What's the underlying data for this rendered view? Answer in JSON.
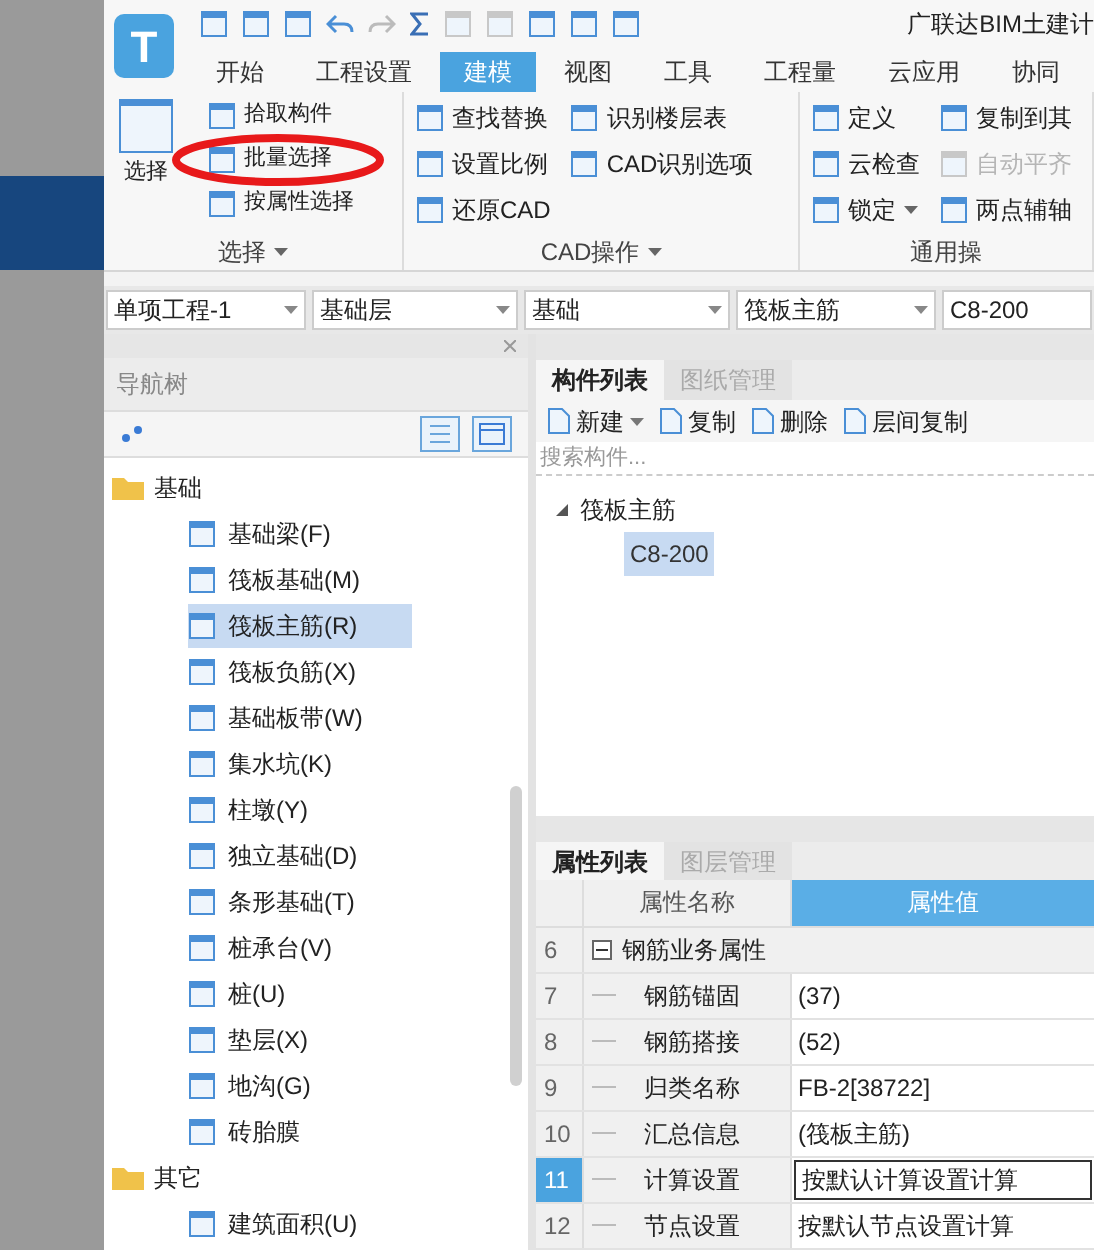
{
  "window": {
    "title": "广联达BIM土建计"
  },
  "app_logo": {
    "letter": "T"
  },
  "menu_tabs": [
    {
      "label": "开始",
      "selected": false
    },
    {
      "label": "工程设置",
      "selected": false
    },
    {
      "label": "建模",
      "selected": true
    },
    {
      "label": "视图",
      "selected": false
    },
    {
      "label": "工具",
      "selected": false
    },
    {
      "label": "工程量",
      "selected": false
    },
    {
      "label": "云应用",
      "selected": false
    },
    {
      "label": "协同",
      "selected": false
    }
  ],
  "ribbon": [
    {
      "label": "选择",
      "columns": [
        [
          {
            "label": "选择",
            "kind": "large",
            "disabled": false,
            "menu": false
          }
        ],
        [
          {
            "label": "拾取构件",
            "kind": "small",
            "disabled": false,
            "menu": false
          },
          {
            "label": "批量选择",
            "kind": "small",
            "disabled": false,
            "menu": false
          },
          {
            "label": "按属性选择",
            "kind": "small",
            "disabled": false,
            "menu": false
          }
        ]
      ]
    },
    {
      "label": "CAD操作",
      "columns": [
        [
          {
            "label": "查找替换",
            "kind": "small",
            "disabled": false,
            "menu": false
          },
          {
            "label": "设置比例",
            "kind": "small",
            "disabled": false,
            "menu": false
          },
          {
            "label": "还原CAD",
            "kind": "small",
            "disabled": false,
            "menu": false
          }
        ],
        [
          {
            "label": "识别楼层表",
            "kind": "small",
            "disabled": false,
            "menu": false
          },
          {
            "label": "CAD识别选项",
            "kind": "small",
            "disabled": false,
            "menu": false
          }
        ]
      ]
    },
    {
      "label": "通用操",
      "columns": [
        [
          {
            "label": "定义",
            "kind": "small",
            "disabled": false,
            "menu": false
          },
          {
            "label": "云检查",
            "kind": "small",
            "disabled": false,
            "menu": false
          },
          {
            "label": "锁定",
            "kind": "small",
            "disabled": false,
            "menu": true
          }
        ],
        [
          {
            "label": "复制到其",
            "kind": "small",
            "disabled": false,
            "menu": false
          },
          {
            "label": "自动平齐",
            "kind": "small",
            "disabled": true,
            "menu": false
          },
          {
            "label": "两点辅轴",
            "kind": "small",
            "disabled": false,
            "menu": false
          }
        ]
      ]
    }
  ],
  "selectors": [
    {
      "value": "单项工程-1",
      "caret": true
    },
    {
      "value": "基础层",
      "caret": true
    },
    {
      "value": "基础",
      "caret": true
    },
    {
      "value": "筏板主筋",
      "caret": true
    },
    {
      "value": "C8-200",
      "caret": false
    }
  ],
  "nav_tree": {
    "title": "导航树",
    "folders": [
      {
        "label": "基础",
        "children": [
          {
            "label": "基础梁(F)",
            "selected": false
          },
          {
            "label": "筏板基础(M)",
            "selected": false
          },
          {
            "label": "筏板主筋(R)",
            "selected": true
          },
          {
            "label": "筏板负筋(X)",
            "selected": false
          },
          {
            "label": "基础板带(W)",
            "selected": false
          },
          {
            "label": "集水坑(K)",
            "selected": false
          },
          {
            "label": "柱墩(Y)",
            "selected": false
          },
          {
            "label": "独立基础(D)",
            "selected": false
          },
          {
            "label": "条形基础(T)",
            "selected": false
          },
          {
            "label": "桩承台(V)",
            "selected": false
          },
          {
            "label": "桩(U)",
            "selected": false
          },
          {
            "label": "垫层(X)",
            "selected": false
          },
          {
            "label": "地沟(G)",
            "selected": false
          },
          {
            "label": "砖胎膜",
            "selected": false
          }
        ]
      },
      {
        "label": "其它",
        "children": [
          {
            "label": "建筑面积(U)",
            "selected": false
          }
        ]
      }
    ]
  },
  "component_panel": {
    "tabs": [
      {
        "label": "构件列表",
        "selected": true
      },
      {
        "label": "图纸管理",
        "selected": false
      }
    ],
    "toolbar": [
      {
        "label": "新建",
        "menu": true
      },
      {
        "label": "复制",
        "menu": false
      },
      {
        "label": "删除",
        "menu": false
      },
      {
        "label": "层间复制",
        "menu": false
      }
    ],
    "search": {
      "placeholder": "搜索构件..."
    },
    "tree": [
      {
        "label": "筏板主筋",
        "expanded": true,
        "children": [
          {
            "label": "C8-200",
            "selected": true
          }
        ]
      }
    ]
  },
  "properties": {
    "tabs": [
      {
        "label": "属性列表",
        "selected": true
      },
      {
        "label": "图层管理",
        "selected": false
      }
    ],
    "columns": [
      "属性名称",
      "属性值"
    ],
    "rows": [
      {
        "index": "6",
        "name": "钢筋业务属性",
        "kind": "group",
        "expanded": true,
        "selected": false
      },
      {
        "index": "7",
        "name": "钢筋锚固",
        "value": "(37)",
        "kind": "item",
        "selected": false
      },
      {
        "index": "8",
        "name": "钢筋搭接",
        "value": "(52)",
        "kind": "item",
        "selected": false
      },
      {
        "index": "9",
        "name": "归类名称",
        "value": "FB-2[38722]",
        "kind": "item",
        "selected": false
      },
      {
        "index": "10",
        "name": "汇总信息",
        "value": "(筏板主筋)",
        "kind": "item",
        "selected": false
      },
      {
        "index": "11",
        "name": "计算设置",
        "value": "按默认计算设置计算",
        "kind": "item",
        "selected": true
      },
      {
        "index": "12",
        "name": "节点设置",
        "value": "按默认节点设置计算",
        "kind": "item",
        "selected": false
      }
    ]
  }
}
